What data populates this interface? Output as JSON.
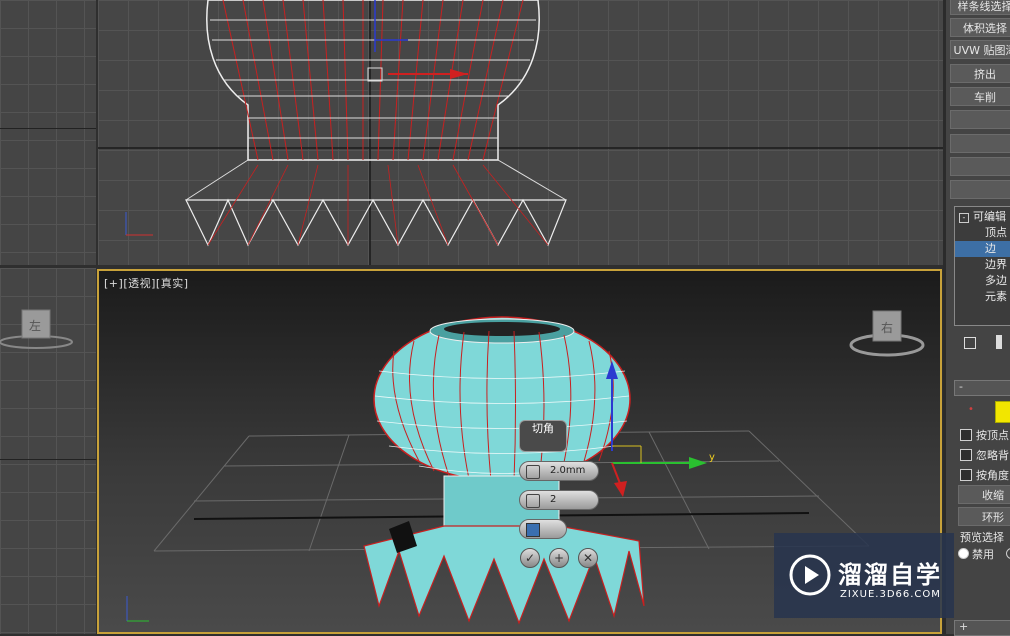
{
  "viewports": {
    "perspective": {
      "label_plus": "[+]",
      "label_view": "[透视]",
      "label_shading": "[真实]",
      "viewcube_face": "右"
    },
    "left": {
      "viewcube_face": "左"
    }
  },
  "command_panel": {
    "modifier_buttons": [
      "样条线选择",
      "体积选择",
      "UVW 贴图添",
      "挤出",
      "车削",
      "",
      "",
      "",
      ""
    ],
    "stack": {
      "root": "可编辑",
      "items": [
        "顶点",
        "边",
        "边界",
        "多边",
        "元素"
      ],
      "selected_index": 1
    },
    "selection_rollout": {
      "collapse": "-",
      "checkboxes": [
        "按顶点",
        "忽略背",
        "按角度"
      ],
      "buttons": [
        "收缩",
        "环形"
      ],
      "preview_label": "预览选择",
      "preview_option": "禁用"
    },
    "bottom_collapse": "+"
  },
  "chamfer_caddy": {
    "title": "切角",
    "amount_value": "2.0mm",
    "segments_value": "2",
    "ok_icon": "check-icon",
    "apply_icon": "plus-icon",
    "cancel_icon": "x-icon"
  },
  "gizmo": {
    "y_label": "y"
  },
  "watermark": {
    "title": "溜溜自学",
    "url": "ZIXUE.3D66.COM"
  },
  "colors": {
    "active_viewport_border": "#c8a23a",
    "selected_stack_item": "#3d6fa5",
    "mesh_fill": "#7fd8d8",
    "wire_red": "#cc2020"
  }
}
